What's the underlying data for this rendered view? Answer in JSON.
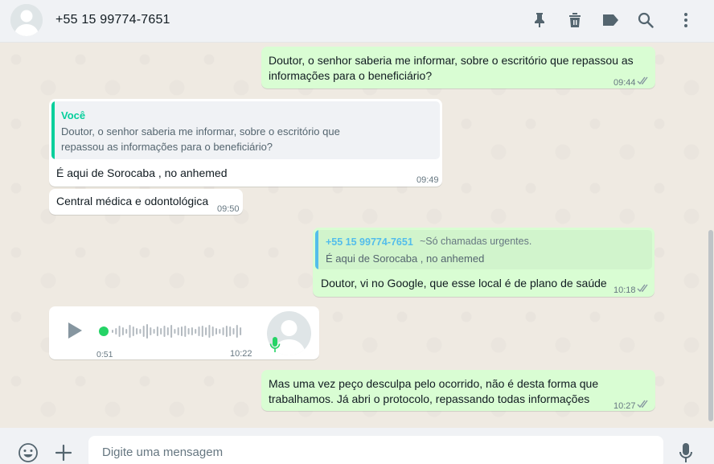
{
  "header": {
    "contact_name": "+55 15 99774-7651",
    "icons": [
      "pin-icon",
      "delete-icon",
      "label-icon",
      "search-icon",
      "menu-icon"
    ]
  },
  "messages": [
    {
      "direction": "outgoing",
      "line1": "Doutor, o senhor saberia me informar, sobre o escritório que repassou as",
      "line2": "informações para o beneficiário?",
      "time": "09:44",
      "status": "read"
    },
    {
      "direction": "incoming",
      "quote_author": "Você",
      "quote_line1": "Doutor, o senhor saberia me informar, sobre o escritório que",
      "quote_line2": "repassou as informações para o beneficiário?",
      "text": "É aqui de Sorocaba , no anhemed",
      "time": "09:49"
    },
    {
      "direction": "incoming",
      "text": "Central médica e odontológica",
      "time": "09:50"
    },
    {
      "direction": "outgoing",
      "quote_author": "+55 15 99774-7651",
      "quote_pushname": "~Só chamadas urgentes.",
      "quote_text": "É aqui de Sorocaba , no anhemed",
      "text": "Doutor, vi no Google, que esse local é de plano de saúde",
      "time": "10:18",
      "status": "read"
    },
    {
      "direction": "incoming",
      "type": "voice",
      "duration": "0:51",
      "time": "10:22"
    },
    {
      "direction": "outgoing",
      "line1": "Mas uma vez peço desculpa pelo ocorrido, não é desta forma que",
      "line2": "trabalhamos. Já abri o protocolo, repassando todas informações",
      "time": "10:27",
      "status": "read"
    }
  ],
  "composer": {
    "placeholder": "Digite uma mensagem",
    "value": ""
  },
  "colors": {
    "outgoing_bubble": "#d9fdd3",
    "incoming_bubble": "#ffffff",
    "accent_green": "#25d366",
    "read_ticks": "#8696a0"
  }
}
